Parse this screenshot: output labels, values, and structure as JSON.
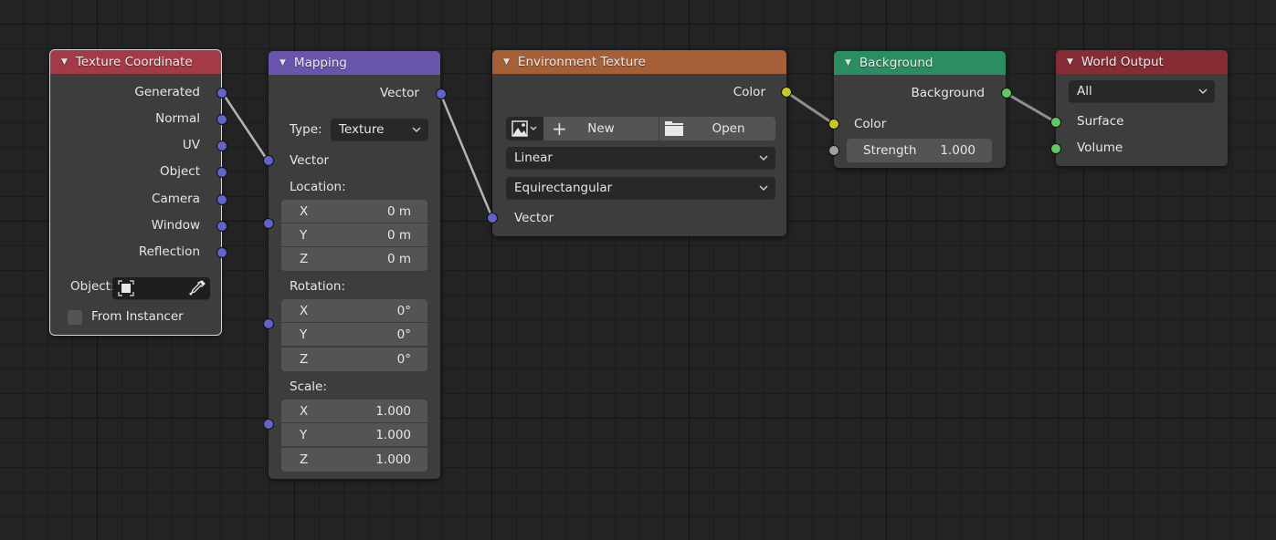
{
  "editor": "Shader Editor (World)",
  "nodes": {
    "texture_coordinate": {
      "title": "Texture Coordinate",
      "header_color": "#a33a47",
      "outputs": [
        "Generated",
        "Normal",
        "UV",
        "Object",
        "Camera",
        "Window",
        "Reflection"
      ],
      "object_label": "Object:",
      "object_value": "",
      "from_instancer_label": "From Instancer",
      "from_instancer_checked": false
    },
    "mapping": {
      "title": "Mapping",
      "header_color": "#6a55ad",
      "output": "Vector",
      "type_label": "Type:",
      "type_value": "Texture",
      "input_vector": "Vector",
      "location_label": "Location:",
      "location": [
        {
          "axis": "X",
          "value": "0 m"
        },
        {
          "axis": "Y",
          "value": "0 m"
        },
        {
          "axis": "Z",
          "value": "0 m"
        }
      ],
      "rotation_label": "Rotation:",
      "rotation": [
        {
          "axis": "X",
          "value": "0°"
        },
        {
          "axis": "Y",
          "value": "0°"
        },
        {
          "axis": "Z",
          "value": "0°"
        }
      ],
      "scale_label": "Scale:",
      "scale": [
        {
          "axis": "X",
          "value": "1.000"
        },
        {
          "axis": "Y",
          "value": "1.000"
        },
        {
          "axis": "Z",
          "value": "1.000"
        }
      ]
    },
    "environment_texture": {
      "title": "Environment Texture",
      "header_color": "#a5603a",
      "output": "Color",
      "new_label": "New",
      "open_label": "Open",
      "interpolation": "Linear",
      "projection": "Equirectangular",
      "input_vector": "Vector"
    },
    "background": {
      "title": "Background",
      "header_color": "#2b8e63",
      "output": "Background",
      "input_color": "Color",
      "strength_label": "Strength",
      "strength_value": "1.000"
    },
    "world_output": {
      "title": "World Output",
      "header_color": "#862c35",
      "target": "All",
      "inputs": [
        "Surface",
        "Volume"
      ]
    }
  },
  "socket_colors": {
    "vector": "#6363c7",
    "color": "#c7c729",
    "shader": "#63c763",
    "float": "#a1a1a1"
  }
}
